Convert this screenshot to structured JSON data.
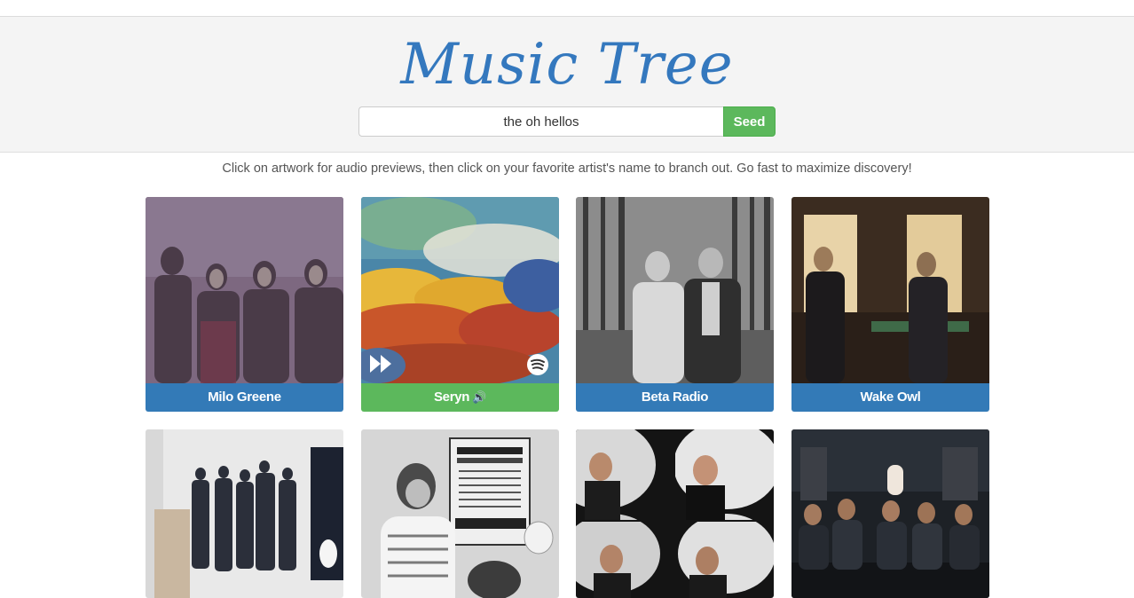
{
  "app": {
    "title": "Music Tree"
  },
  "search": {
    "value": "the oh hellos",
    "button_label": "Seed"
  },
  "instructions": "Click on artwork for audio previews, then click on your favorite artist's name to branch out. Go fast to maximize discovery!",
  "artists": [
    {
      "name": "Milo Greene",
      "playing": false
    },
    {
      "name": "Seryn",
      "playing": true,
      "speaker_icon": "🔊"
    },
    {
      "name": "Beta Radio",
      "playing": false
    },
    {
      "name": "Wake Owl",
      "playing": false
    }
  ],
  "colors": {
    "brand_blue": "#337ab7",
    "seed_green": "#5cb85c",
    "logo_blue": "#3478be"
  }
}
